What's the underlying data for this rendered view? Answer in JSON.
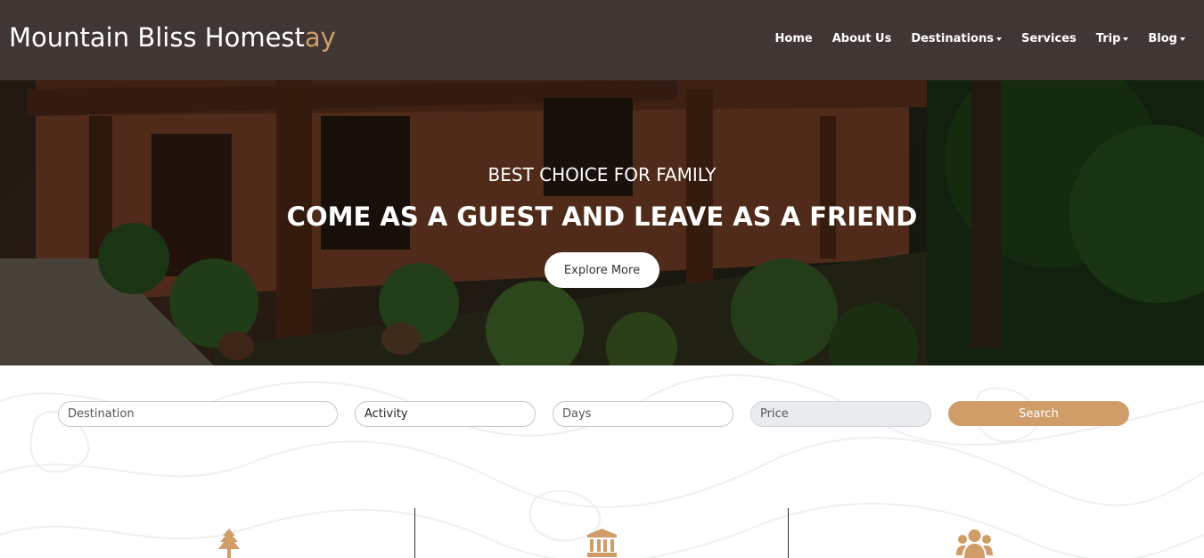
{
  "brand": {
    "name_main": "Mountain Bliss Homest",
    "name_accent": "ay"
  },
  "nav": [
    {
      "label": "Home",
      "dropdown": false
    },
    {
      "label": "About Us",
      "dropdown": false
    },
    {
      "label": "Destinations",
      "dropdown": true
    },
    {
      "label": "Services",
      "dropdown": false
    },
    {
      "label": "Trip",
      "dropdown": true
    },
    {
      "label": "Blog",
      "dropdown": true
    }
  ],
  "hero": {
    "subtitle": "BEST CHOICE FOR FAMILY",
    "title": "COME AS A GUEST AND LEAVE AS A FRIEND",
    "button_label": "Explore More"
  },
  "search": {
    "destination_placeholder": "Destination",
    "activity_value": "Activity",
    "days_placeholder": "Days",
    "price_placeholder": "Price",
    "button_label": "Search"
  },
  "features": [
    {
      "icon": "tree-icon"
    },
    {
      "icon": "bank-icon"
    },
    {
      "icon": "users-icon"
    }
  ],
  "colors": {
    "navbar": "#403734",
    "accent": "#d09d68",
    "white": "#ffffff"
  }
}
